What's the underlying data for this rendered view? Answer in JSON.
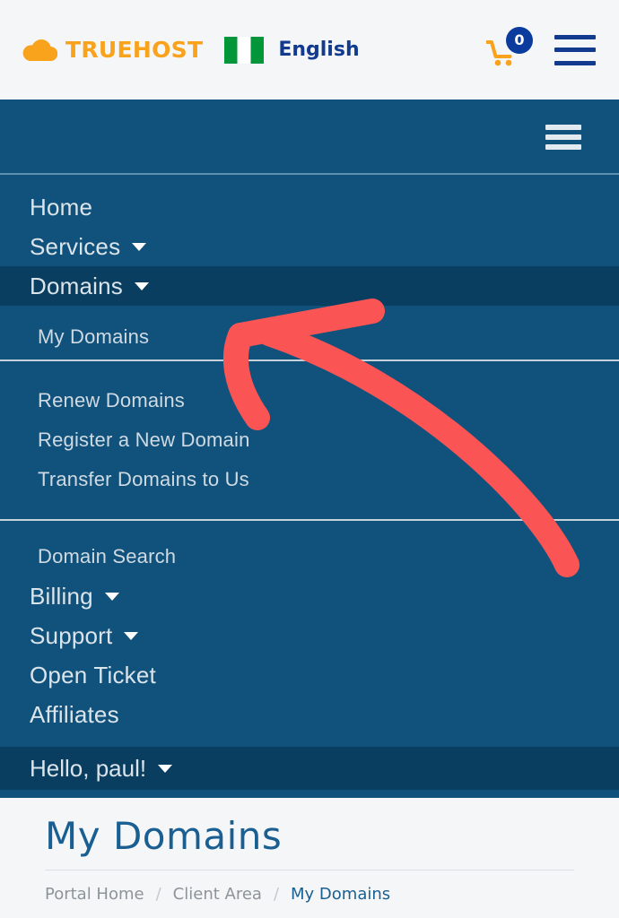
{
  "header": {
    "brand_name": "TRUEHOST",
    "brand_icon": "cloud-icon",
    "flag_name": "nigeria-flag",
    "language": "English",
    "cart_icon": "shopping-cart-icon",
    "cart_count": "0",
    "menu_icon": "hamburger-menu-icon",
    "brand_color": "#f9a21b",
    "accent_color": "#123b8f"
  },
  "nav": {
    "toggle_icon": "hamburger-menu-icon",
    "background_color": "#11527c",
    "active_color": "#0a3e60",
    "items": [
      {
        "label": "Home",
        "caret": false
      },
      {
        "label": "Services",
        "caret": true
      },
      {
        "label": "Domains",
        "caret": true
      }
    ],
    "submenu_primary": [
      {
        "label": "My Domains"
      }
    ],
    "submenu_group_a": [
      {
        "label": "Renew Domains"
      },
      {
        "label": "Register a New Domain"
      },
      {
        "label": "Transfer Domains to Us"
      }
    ],
    "submenu_group_b": [
      {
        "label": "Domain Search"
      }
    ],
    "items_tail": [
      {
        "label": "Billing",
        "caret": true
      },
      {
        "label": "Support",
        "caret": true
      },
      {
        "label": "Open Ticket",
        "caret": false
      },
      {
        "label": "Affiliates",
        "caret": false
      }
    ],
    "user_greeting": "Hello, paul!"
  },
  "main": {
    "page_title": "My Domains",
    "breadcrumb": [
      {
        "label": "Portal Home",
        "current": false
      },
      {
        "label": "Client Area",
        "current": false
      },
      {
        "label": "My Domains",
        "current": true
      }
    ],
    "breadcrumb_separator": "/",
    "title_color": "#1a5f91"
  },
  "annotation": {
    "name": "red-arrow-pointing-to-my-domains",
    "color": "#fb5454"
  }
}
